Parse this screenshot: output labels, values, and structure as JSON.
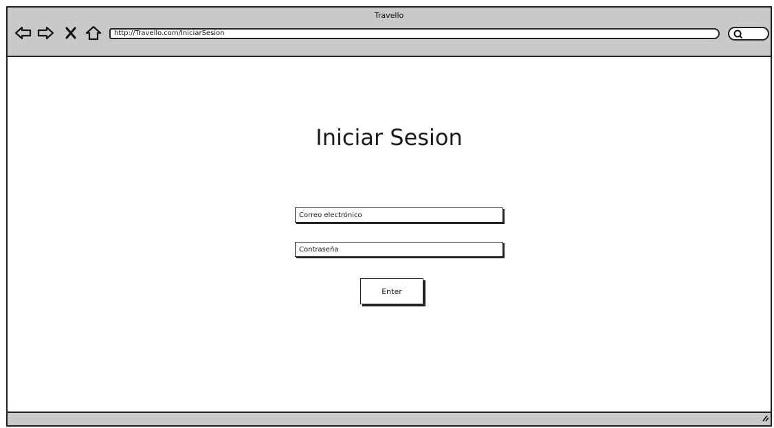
{
  "window": {
    "title": "Travello"
  },
  "toolbar": {
    "url": "http://Travello.com/IniciarSesion",
    "icons": [
      "back-arrow-icon",
      "forward-arrow-icon",
      "close-icon",
      "home-icon",
      "search-icon"
    ]
  },
  "login": {
    "title": "Iniciar Sesion",
    "email_placeholder": "Correo electrónico",
    "password_placeholder": "Contraseña",
    "submit_label": "Enter"
  }
}
